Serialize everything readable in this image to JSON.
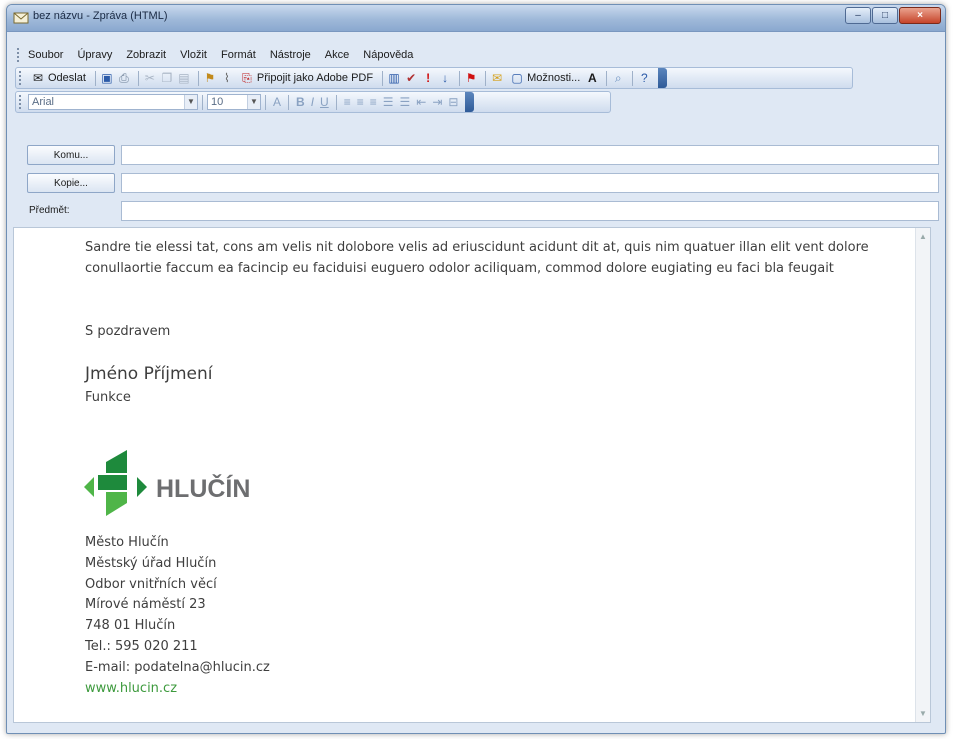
{
  "window": {
    "title": "bez názvu - Zpráva (HTML)",
    "controls": [
      "minimize",
      "maximize",
      "close"
    ]
  },
  "menu": [
    "Soubor",
    "Úpravy",
    "Zobrazit",
    "Vložit",
    "Formát",
    "Nástroje",
    "Akce",
    "Nápověda"
  ],
  "toolbar": {
    "send_label": "Odeslat",
    "attach_pdf_label": "Připojit jako Adobe PDF",
    "options_label": "Možnosti...",
    "icons": [
      "save-icon",
      "print-icon",
      "cut-icon",
      "copy-icon",
      "paste-icon",
      "attach-icon",
      "paperclip-icon",
      "pdf-icon",
      "address-book-icon",
      "check-names-icon",
      "high-importance-icon",
      "low-importance-icon",
      "flag-icon",
      "envelope-icon",
      "options-icon",
      "font-size-icon",
      "zoom-icon",
      "help-icon"
    ]
  },
  "format": {
    "font": "Arial",
    "size": "10",
    "buttons": [
      "A",
      "B",
      "I",
      "U"
    ]
  },
  "header": {
    "to_button": "Komu...",
    "cc_button": "Kopie...",
    "subject_label": "Předmět:",
    "to_value": "",
    "cc_value": "",
    "subject_value": ""
  },
  "body": {
    "paragraph": "Sandre tie elessi tat, cons am velis nit dolobore velis ad eriuscidunt acidunt dit at, quis nim quatuer illan elit vent dolore conullaortie faccum ea facincip eu faciduisi euguero odolor aciliquam, commod dolore eugiating eu faci bla feugait",
    "closing": "S pozdravem",
    "name": "Jméno Příjmení",
    "function": "Funkce",
    "logo_text": "HLUČÍN",
    "address": [
      "Město Hlučín",
      "Městský úřad Hlučín",
      "Odbor vnitřních věcí",
      "Mírové náměstí 23",
      "748 01 Hlučín",
      "Tel.: 595 020 211",
      "E-mail: podatelna@hlucin.cz"
    ],
    "website": "www.hlucin.cz"
  },
  "colors": {
    "logo_green_dark": "#1e8a3c",
    "logo_green_light": "#4fb548",
    "logo_text": "#6d6e70",
    "link_green": "#3d9a3d"
  }
}
